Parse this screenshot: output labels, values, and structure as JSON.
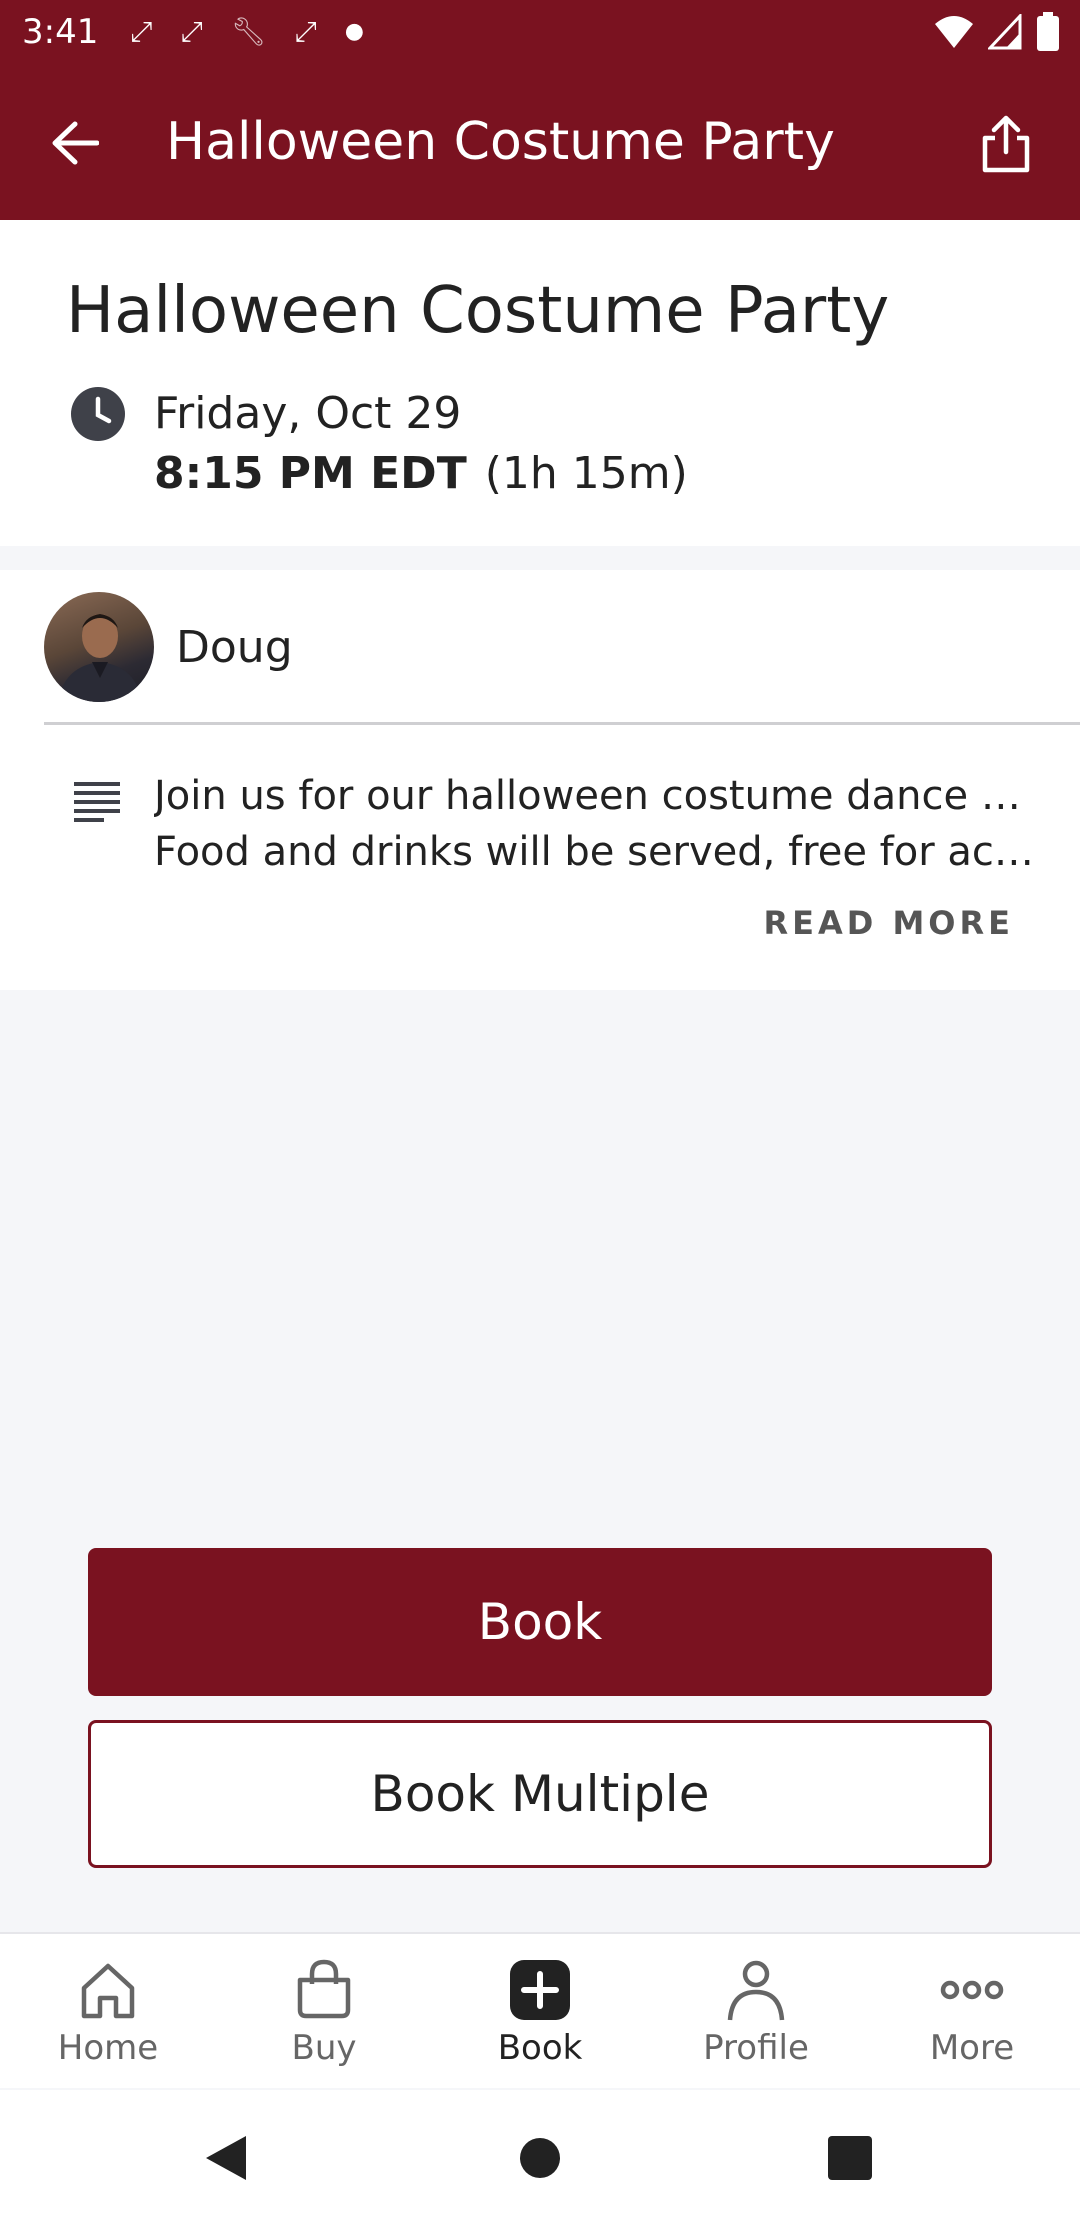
{
  "status_bar": {
    "time": "3:41",
    "left_icons": [
      "sync-icon",
      "sync-icon",
      "wrench-icon",
      "sync-icon",
      "dot-icon"
    ],
    "right_icons": [
      "wifi-icon",
      "signal-icon",
      "battery-icon"
    ]
  },
  "app_bar": {
    "title": "Halloween Costume Party",
    "back_icon": "arrow-left-icon",
    "share_icon": "share-icon",
    "color": "#7a1220"
  },
  "event": {
    "title": "Halloween Costume Party",
    "date": "Friday, Oct 29",
    "time": "8:15 PM EDT",
    "duration": "(1h 15m)"
  },
  "host": {
    "name": "Doug"
  },
  "description": {
    "line1": "Join us for our halloween costume dance party!",
    "line2": "Food and drinks will be served, free for active …",
    "read_more": "READ MORE"
  },
  "actions": {
    "book": "Book",
    "book_multiple": "Book Multiple"
  },
  "bottom_nav": {
    "items": [
      {
        "label": "Home",
        "icon": "home-icon"
      },
      {
        "label": "Buy",
        "icon": "shopping-bag-icon"
      },
      {
        "label": "Book",
        "icon": "plus-square-icon",
        "active": true
      },
      {
        "label": "Profile",
        "icon": "person-icon"
      },
      {
        "label": "More",
        "icon": "more-horizontal-icon"
      }
    ]
  }
}
